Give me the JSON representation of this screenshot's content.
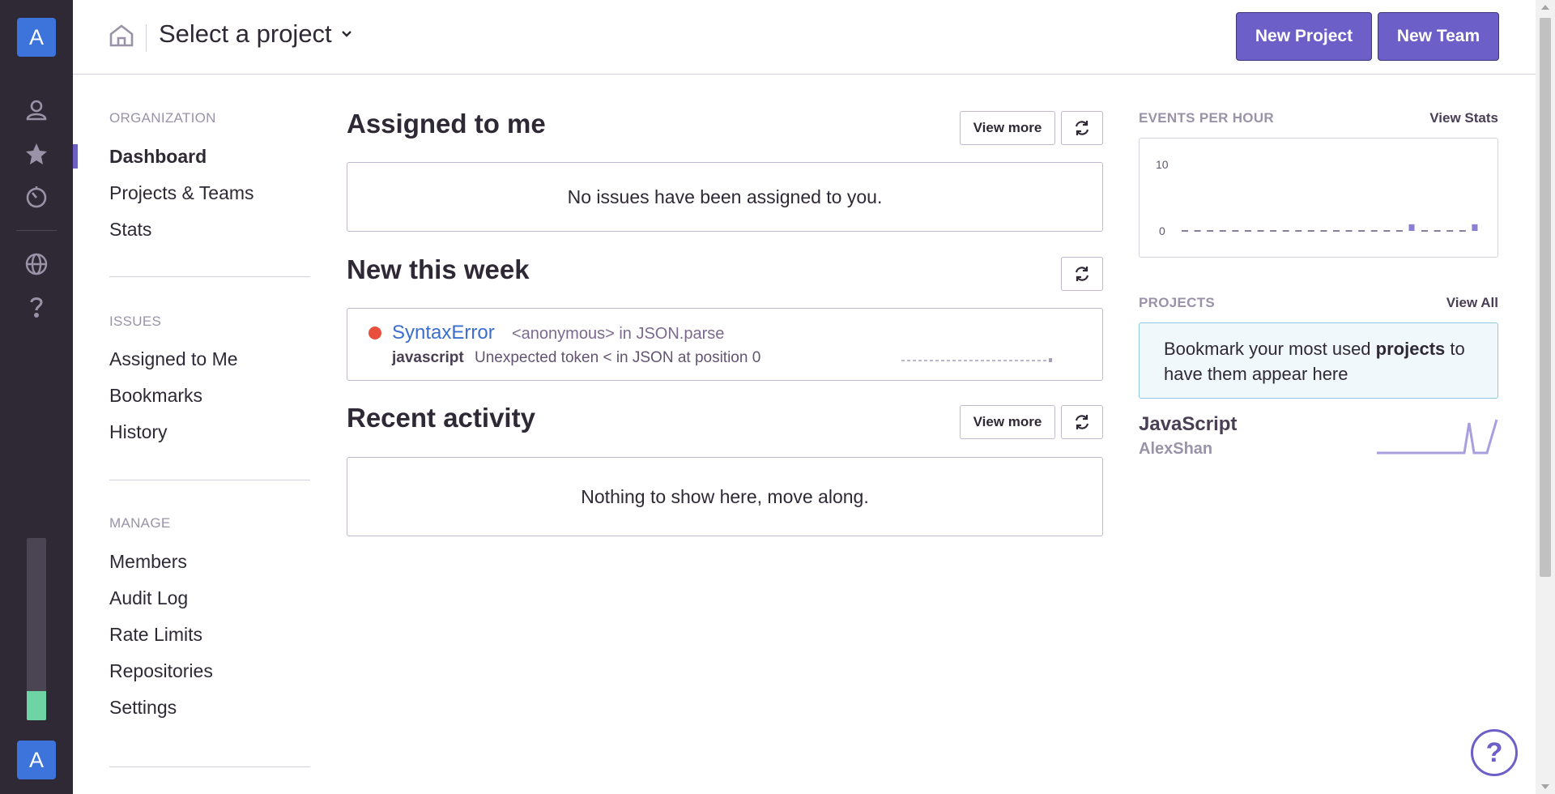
{
  "rail": {
    "org_initial": "A",
    "user_initial": "A",
    "icons": [
      "user-icon",
      "star-icon",
      "activity-icon",
      "globe-icon",
      "question-icon"
    ],
    "usage_fraction": 0.16
  },
  "header": {
    "project_select": "Select a project",
    "new_project": "New Project",
    "new_team": "New Team"
  },
  "nav": {
    "organization": {
      "title": "ORGANIZATION",
      "items": [
        "Dashboard",
        "Projects & Teams",
        "Stats"
      ],
      "active": "Dashboard"
    },
    "issues": {
      "title": "ISSUES",
      "items": [
        "Assigned to Me",
        "Bookmarks",
        "History"
      ]
    },
    "manage": {
      "title": "MANAGE",
      "items": [
        "Members",
        "Audit Log",
        "Rate Limits",
        "Repositories",
        "Settings"
      ]
    }
  },
  "main": {
    "assigned": {
      "title": "Assigned to me",
      "view_more": "View more",
      "empty": "No issues have been assigned to you."
    },
    "new_week": {
      "title": "New this week",
      "issue": {
        "title": "SyntaxError",
        "culprit": "<anonymous> in JSON.parse",
        "platform": "javascript",
        "message": "Unexpected token < in JSON at position 0"
      }
    },
    "recent": {
      "title": "Recent activity",
      "view_more": "View more",
      "empty": "Nothing to show here, move along."
    }
  },
  "right": {
    "events": {
      "title": "EVENTS PER HOUR",
      "link": "View Stats"
    },
    "projects": {
      "title": "PROJECTS",
      "link": "View All",
      "bookmark_pre": "Bookmark your most used ",
      "bookmark_bold": "projects",
      "bookmark_post": " to have them appear here",
      "project_name": "JavaScript",
      "team": "AlexShan"
    }
  },
  "colors": {
    "accent": "#6c5fc7",
    "rail": "#2f2936",
    "link": "#3b6ecc",
    "error": "#e84f3d",
    "usage_fill": "#6fd4a3"
  },
  "chart_data": {
    "type": "bar",
    "title": "EVENTS PER HOUR",
    "yticks": [
      0,
      10
    ],
    "ylim": [
      0,
      10
    ],
    "categories": [
      "1",
      "2",
      "3",
      "4",
      "5",
      "6",
      "7",
      "8",
      "9",
      "10",
      "11",
      "12",
      "13",
      "14",
      "15",
      "16",
      "17",
      "18",
      "19",
      "20",
      "21",
      "22",
      "23",
      "24"
    ],
    "values": [
      0,
      0,
      0,
      0,
      0,
      0,
      0,
      0,
      0,
      0,
      0,
      0,
      0,
      0,
      0,
      0,
      0,
      0,
      1,
      0,
      0,
      0,
      0,
      1
    ]
  }
}
